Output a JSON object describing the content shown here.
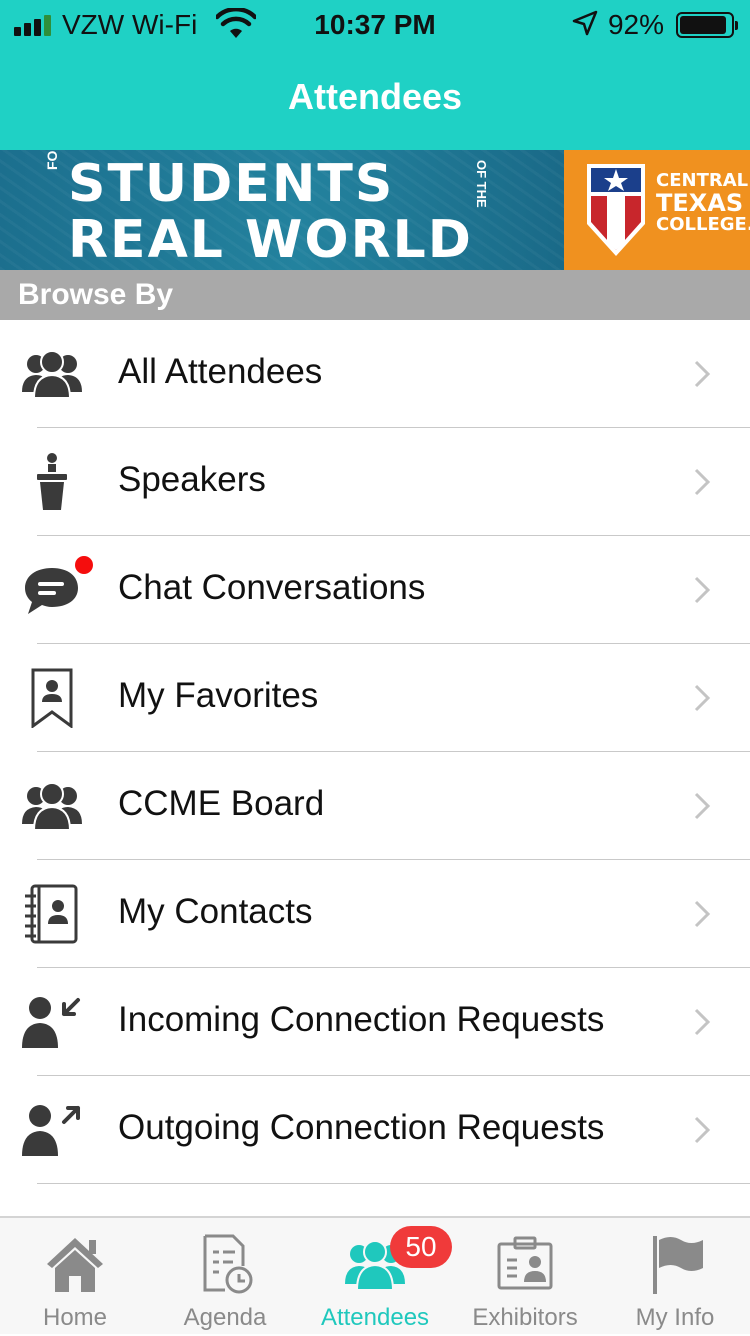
{
  "status_bar": {
    "carrier": "VZW Wi-Fi",
    "time": "10:37 PM",
    "battery": "92%",
    "battery_level": 0.92
  },
  "nav": {
    "title": "Attendees"
  },
  "banner": {
    "line1": "STUDENTS",
    "line2": "REAL WORLD",
    "for_text": "FOR",
    "of_the_text": "OF THE",
    "college_line1": "CENTRAL",
    "college_line2": "TEXAS",
    "college_line3": "COLLEGE.",
    "colors": {
      "blue": "#1c6f8e",
      "orange": "#f0911f"
    }
  },
  "section_header": "Browse By",
  "menu": [
    {
      "label": "All Attendees",
      "icon": "group-icon"
    },
    {
      "label": "Speakers",
      "icon": "speaker-podium-icon"
    },
    {
      "label": "Chat Conversations",
      "icon": "chat-bubble-icon",
      "unread_dot": true
    },
    {
      "label": "My Favorites",
      "icon": "bookmark-person-icon"
    },
    {
      "label": "CCME Board",
      "icon": "group-icon"
    },
    {
      "label": "My Contacts",
      "icon": "address-book-icon"
    },
    {
      "label": "Incoming Connection Requests",
      "icon": "person-incoming-icon"
    },
    {
      "label": "Outgoing Connection Requests",
      "icon": "person-outgoing-icon"
    }
  ],
  "tabbar": {
    "tabs": [
      {
        "label": "Home",
        "icon": "home-icon"
      },
      {
        "label": "Agenda",
        "icon": "agenda-icon"
      },
      {
        "label": "Attendees",
        "icon": "attendees-icon",
        "active": true,
        "badge": "50"
      },
      {
        "label": "Exhibitors",
        "icon": "exhibitors-icon"
      },
      {
        "label": "My Info",
        "icon": "flag-icon"
      }
    ]
  },
  "colors": {
    "accent": "#1fd1c5",
    "badge": "#f03a3a",
    "unread_dot": "#f50d0d"
  }
}
